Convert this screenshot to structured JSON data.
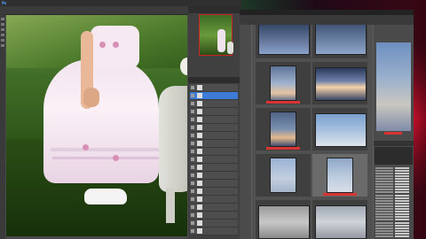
{
  "photoshop": {
    "menu": [
      "",
      "",
      "",
      "",
      "",
      "",
      ""
    ],
    "navigator_tabs": [
      "",
      "",
      ""
    ],
    "layers": [
      {
        "name": "",
        "selected": false
      },
      {
        "name": "",
        "selected": true
      },
      {
        "name": "",
        "selected": false
      },
      {
        "name": "",
        "selected": false
      },
      {
        "name": "",
        "selected": false
      },
      {
        "name": "",
        "selected": false
      },
      {
        "name": "",
        "selected": false
      },
      {
        "name": "",
        "selected": false
      },
      {
        "name": "",
        "selected": false
      },
      {
        "name": "",
        "selected": false
      },
      {
        "name": "",
        "selected": false
      },
      {
        "name": "",
        "selected": false
      },
      {
        "name": "",
        "selected": false
      },
      {
        "name": "",
        "selected": false
      },
      {
        "name": "",
        "selected": false
      },
      {
        "name": "",
        "selected": false
      },
      {
        "name": "",
        "selected": false
      },
      {
        "name": "",
        "selected": false
      },
      {
        "name": "",
        "selected": false
      }
    ]
  },
  "bridge": {
    "thumbnails": [
      {
        "style": "sky9",
        "label_color": "",
        "selected": false
      },
      {
        "style": "sky10",
        "label_color": "",
        "selected": false
      },
      {
        "style": "sky1",
        "label_color": "#d83434",
        "selected": false
      },
      {
        "style": "sky2",
        "label_color": "",
        "selected": false
      },
      {
        "style": "sky4",
        "label_color": "#d83434",
        "selected": false
      },
      {
        "style": "sky3",
        "label_color": "",
        "selected": false
      },
      {
        "style": "sky6",
        "label_color": "",
        "selected": false
      },
      {
        "style": "sky5",
        "label_color": "#d83434",
        "selected": true
      },
      {
        "style": "sky7",
        "label_color": "",
        "selected": false
      },
      {
        "style": "sky8",
        "label_color": "",
        "selected": false
      }
    ],
    "preview_label_color": "#d83434"
  },
  "colors": {
    "label_red": "#d83434",
    "layer_selected": "#3d7bd6",
    "navigator_frame": "#cc2222"
  }
}
